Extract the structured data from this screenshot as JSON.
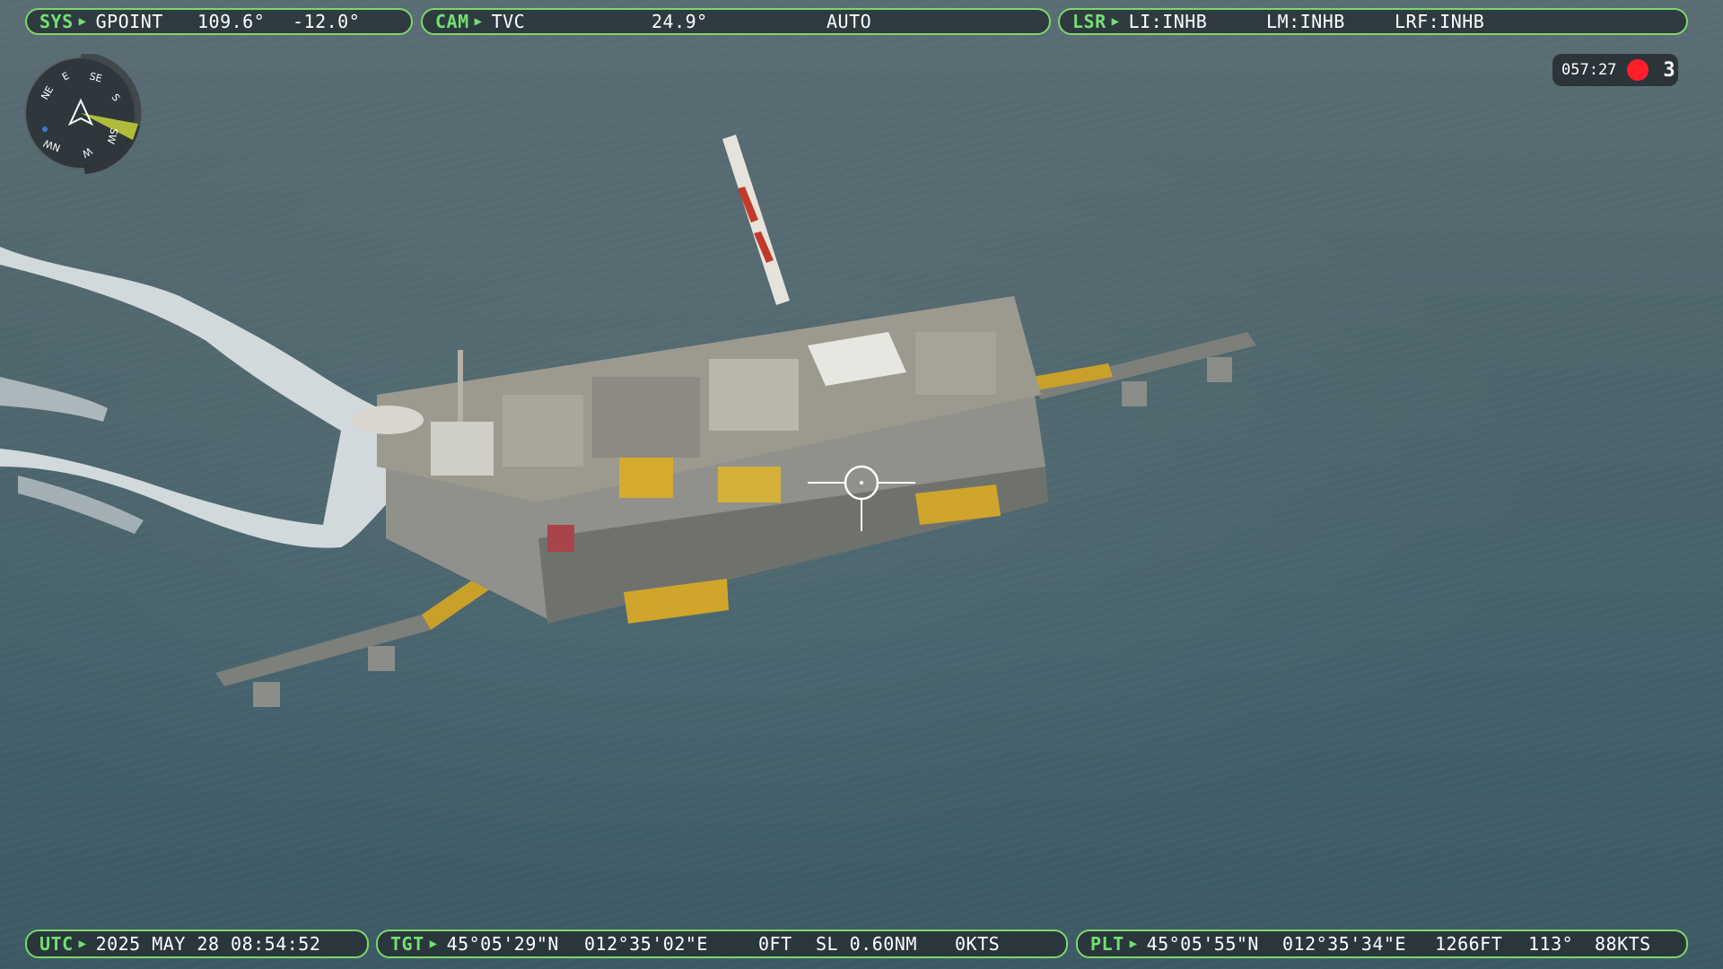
{
  "top_bars": {
    "sys": {
      "tag": "SYS",
      "mode": "GPOINT",
      "azimuth": "109.6°",
      "elevation": "-12.0°"
    },
    "cam": {
      "tag": "CAM",
      "mode": "TVC",
      "fov": "24.9°",
      "focus": "AUTO"
    },
    "lsr": {
      "tag": "LSR",
      "li": "LI:INHB",
      "lm": "LM:INHB",
      "lrf": "LRF:INHB"
    }
  },
  "recording": {
    "time": "057:27",
    "count": "3",
    "color": "#ff1f2c"
  },
  "compass": {
    "labels": [
      "NE",
      "E",
      "SE",
      "S",
      "SW",
      "W",
      "NW"
    ],
    "sector_color": "#c8d43a"
  },
  "bottom_bars": {
    "utc": {
      "tag": "UTC",
      "datetime": "2025 MAY 28 08:54:52"
    },
    "tgt": {
      "tag": "TGT",
      "lat": "45°05'29\"N",
      "lon": "012°35'02\"E",
      "alt": "0FT",
      "range": "SL 0.60NM",
      "speed": "0KTS"
    },
    "plt": {
      "tag": "PLT",
      "lat": "45°05'55\"N",
      "lon": "012°35'34\"E",
      "alt": "1266FT",
      "heading": "113°",
      "speed": "88KTS"
    }
  },
  "colors": {
    "hud_green": "#7cd86b",
    "tag_green": "#74e070",
    "hud_text": "#ffffff"
  },
  "icons": {
    "play_marker": "triangle-right-icon",
    "reticle": "crosshair-icon",
    "compass": "compass-icon"
  }
}
